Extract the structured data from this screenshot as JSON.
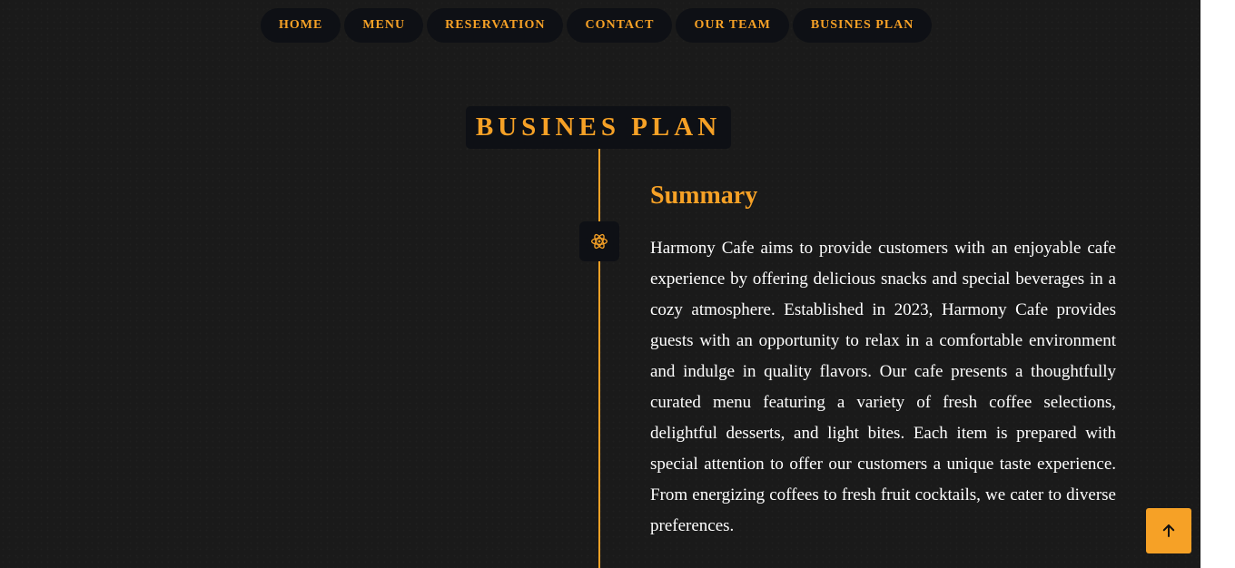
{
  "nav": {
    "items": [
      {
        "label": "HOME"
      },
      {
        "label": "MENU"
      },
      {
        "label": "RESERVATION"
      },
      {
        "label": "CONTACT"
      },
      {
        "label": "OUR TEAM"
      },
      {
        "label": "BUSINES PLAN"
      }
    ]
  },
  "section": {
    "title": "BUSINES PLAN",
    "icon": "atom-icon"
  },
  "summary": {
    "title": "Summary",
    "text": "Harmony Cafe aims to provide customers with an enjoyable cafe experience by offering delicious snacks and special beverages in a cozy atmosphere. Established in 2023, Harmony Cafe provides guests with an opportunity to relax in a comfortable environment and indulge in quality flavors. Our cafe presents a thoughtfully curated menu featuring a variety of fresh coffee selections, delightful desserts, and light bites. Each item is prepared with special attention to offer our customers a unique taste experience. From energizing coffees to fresh fruit cocktails, we cater to diverse preferences."
  },
  "scroll_top": {
    "icon": "arrow-up-icon"
  },
  "colors": {
    "accent": "#f6a126",
    "background": "#1a1a1a",
    "panel": "#0e1015",
    "text": "#ffffff"
  }
}
